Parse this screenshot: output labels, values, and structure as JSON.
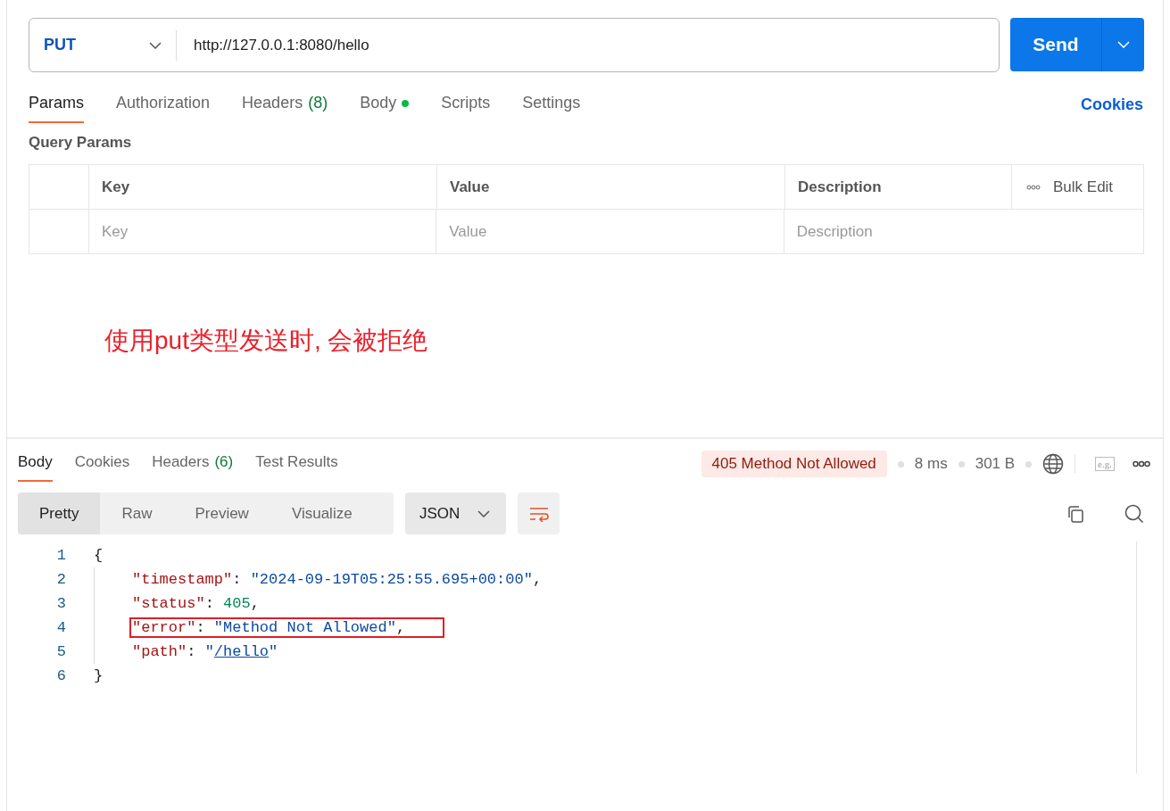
{
  "request": {
    "method": "PUT",
    "url": "http://127.0.0.1:8080/hello",
    "send_label": "Send"
  },
  "request_tabs": [
    {
      "label": "Params",
      "selected": true
    },
    {
      "label": "Authorization",
      "selected": false
    },
    {
      "label": "Headers",
      "count": "(8)",
      "selected": false
    },
    {
      "label": "Body",
      "indicator": true,
      "selected": false
    },
    {
      "label": "Scripts",
      "selected": false
    },
    {
      "label": "Settings",
      "selected": false
    }
  ],
  "cookies_link": "Cookies",
  "query_params": {
    "title": "Query Params",
    "columns": [
      "Key",
      "Value",
      "Description"
    ],
    "bulk_edit": "Bulk Edit",
    "placeholders": [
      "Key",
      "Value",
      "Description"
    ]
  },
  "annotation": "使用put类型发送时, 会被拒绝",
  "response_tabs": [
    {
      "label": "Body",
      "selected": true
    },
    {
      "label": "Cookies",
      "selected": false
    },
    {
      "label": "Headers",
      "count": "(6)",
      "selected": false
    },
    {
      "label": "Test Results",
      "selected": false
    }
  ],
  "response_meta": {
    "status": "405 Method Not Allowed",
    "time": "8 ms",
    "size": "301 B",
    "example_label": "e.g."
  },
  "view_modes": [
    {
      "label": "Pretty",
      "selected": true
    },
    {
      "label": "Raw",
      "selected": false
    },
    {
      "label": "Preview",
      "selected": false
    },
    {
      "label": "Visualize",
      "selected": false
    }
  ],
  "format": "JSON",
  "code": [
    {
      "number": "1",
      "boxed": false,
      "tokens": [
        {
          "kind": "punct",
          "text": "{"
        }
      ],
      "children": [
        {
          "number": "2",
          "boxed": false,
          "tokens": [
            {
              "kind": "key",
              "text": "\"timestamp\""
            },
            {
              "kind": "punct",
              "text": ": "
            },
            {
              "kind": "string",
              "text": "\"2024-09-19T05:25:55.695+00:00\""
            },
            {
              "kind": "punct",
              "text": ","
            }
          ]
        },
        {
          "number": "3",
          "boxed": false,
          "tokens": [
            {
              "kind": "key",
              "text": "\"status\""
            },
            {
              "kind": "punct",
              "text": ": "
            },
            {
              "kind": "number",
              "text": "405"
            },
            {
              "kind": "punct",
              "text": ","
            }
          ]
        },
        {
          "number": "4",
          "boxed": true,
          "tokens": [
            {
              "kind": "key",
              "text": "\"error\""
            },
            {
              "kind": "punct",
              "text": ": "
            },
            {
              "kind": "string",
              "text": "\"Method Not Allowed\""
            },
            {
              "kind": "punct",
              "text": ","
            }
          ]
        },
        {
          "number": "5",
          "boxed": false,
          "tokens": [
            {
              "kind": "key",
              "text": "\"path\""
            },
            {
              "kind": "punct",
              "text": ": "
            },
            {
              "kind": "string",
              "text": "\""
            },
            {
              "kind": "link",
              "text": "/hello"
            },
            {
              "kind": "string",
              "text": "\""
            }
          ]
        }
      ]
    },
    {
      "number": "6",
      "boxed": false,
      "tokens": [
        {
          "kind": "punct",
          "text": "}"
        }
      ]
    }
  ]
}
